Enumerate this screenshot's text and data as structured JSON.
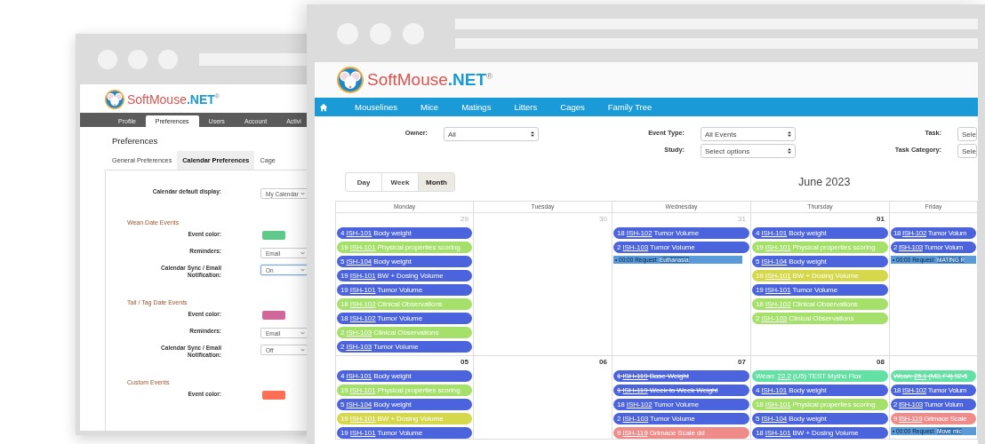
{
  "back_window": {
    "logo": {
      "name": "SoftMouse",
      "suffix": ".NET",
      "mark": "®"
    },
    "nav": [
      {
        "label": "Profile",
        "selected": false
      },
      {
        "label": "Preferences",
        "selected": true
      },
      {
        "label": "Users",
        "selected": false
      },
      {
        "label": "Account",
        "selected": false
      },
      {
        "label": "Activi",
        "selected": false
      }
    ],
    "heading": "Preferences",
    "tabs": [
      {
        "label": "General Preferences",
        "selected": false
      },
      {
        "label": "Calendar Preferences",
        "selected": true
      },
      {
        "label": "Cage",
        "selected": false
      }
    ],
    "settings": [
      {
        "kind": "select",
        "label": "Calendar default display:",
        "value": "My Calendar",
        "focused": false
      },
      {
        "kind": "heading",
        "label": "Wean Date Events"
      },
      {
        "kind": "color",
        "label": "Event color:",
        "color": "#5ec98a"
      },
      {
        "kind": "select",
        "label": "Reminders:",
        "value": "Email",
        "focused": false
      },
      {
        "kind": "select",
        "label": "Calendar Sync / Email Notification:",
        "value": "On",
        "focused": true
      },
      {
        "kind": "heading",
        "label": "Tail / Tag Date Events"
      },
      {
        "kind": "color",
        "label": "Event color:",
        "color": "#d0679a"
      },
      {
        "kind": "select",
        "label": "Reminders:",
        "value": "Email",
        "focused": false
      },
      {
        "kind": "select",
        "label": "Calendar Sync / Email Notification:",
        "value": "Off",
        "focused": false
      },
      {
        "kind": "heading",
        "label": "Custom Events"
      },
      {
        "kind": "color",
        "label": "Event color:",
        "color": "#ff6e55"
      }
    ]
  },
  "front_window": {
    "logo": {
      "name": "SoftMouse",
      "suffix": ".NET",
      "mark": "®"
    },
    "nav": [
      "Mouselines",
      "Mice",
      "Matings",
      "Litters",
      "Cages",
      "Family Tree"
    ],
    "filters": [
      [
        {
          "label": "Owner:",
          "value": "All"
        }
      ],
      [
        {
          "label": "Event Type:",
          "value": "All Events"
        },
        {
          "label": "Study:",
          "value": "Select options"
        }
      ],
      [
        {
          "label": "Task:",
          "value": "Sele"
        },
        {
          "label": "Task Category:",
          "value": "Sele"
        }
      ]
    ],
    "views": [
      {
        "label": "Day",
        "selected": false
      },
      {
        "label": "Week",
        "selected": false
      },
      {
        "label": "Month",
        "selected": true
      }
    ],
    "month_title": "June 2023",
    "weekdays": [
      "Monday",
      "Tuesday",
      "Wednesday",
      "Thursday",
      "Friday"
    ],
    "weeks": [
      {
        "days": [
          {
            "date": "29",
            "other_month": true,
            "events": [
              {
                "kind": "event",
                "count": "4",
                "study": "ISH-101",
                "title": "Body weight",
                "color": "#4b63dc",
                "struck": false
              },
              {
                "kind": "event",
                "count": "19",
                "study": "ISH-101",
                "title": "Physical properties scoring",
                "color": "#a5e16a",
                "struck": false
              },
              {
                "kind": "event",
                "count": "5",
                "study": "ISH-104",
                "title": "Body weight",
                "color": "#4b63dc",
                "struck": false
              },
              {
                "kind": "event",
                "count": "19",
                "study": "ISH-101",
                "title": "BW + Dosing Volume",
                "color": "#4b63dc",
                "struck": false
              },
              {
                "kind": "event",
                "count": "19",
                "study": "ISH-101",
                "title": "Tumor Volume",
                "color": "#4b63dc",
                "struck": false
              },
              {
                "kind": "event",
                "count": "18",
                "study": "ISH-102",
                "title": "Clinical Observations",
                "color": "#a5e16a",
                "struck": false
              },
              {
                "kind": "event",
                "count": "18",
                "study": "ISH-102",
                "title": "Tumor Volume",
                "color": "#4b63dc",
                "struck": false
              },
              {
                "kind": "event",
                "count": "2",
                "study": "ISH-103",
                "title": "Clinical Observations",
                "color": "#a5e16a",
                "struck": false
              },
              {
                "kind": "event",
                "count": "2",
                "study": "ISH-103",
                "title": "Tumor Volume",
                "color": "#4b63dc",
                "struck": false
              }
            ]
          },
          {
            "date": "30",
            "other_month": true
          },
          {
            "date": "31",
            "other_month": true,
            "events": [
              {
                "kind": "event",
                "count": "18",
                "study": "ISH-102",
                "title": "Tumor Volume",
                "color": "#4b63dc",
                "struck": false
              },
              {
                "kind": "event",
                "count": "2",
                "study": "ISH-103",
                "title": "Tumor Volume",
                "color": "#4b63dc",
                "struck": false
              },
              {
                "kind": "request",
                "time": "• 00:00 Request:",
                "title": "Euthanasia"
              }
            ]
          },
          {
            "date": "01",
            "other_month": false,
            "events": [
              {
                "kind": "event",
                "count": "4",
                "study": "ISH-101",
                "title": "Body weight",
                "color": "#4b63dc",
                "struck": false
              },
              {
                "kind": "event",
                "count": "19",
                "study": "ISH-101",
                "title": "Physical properties scoring",
                "color": "#a5e16a",
                "struck": false
              },
              {
                "kind": "event",
                "count": "5",
                "study": "ISH-104",
                "title": "Body weight",
                "color": "#4b63dc",
                "struck": false
              },
              {
                "kind": "event",
                "count": "19",
                "study": "ISH-101",
                "title": "BW + Dosing Volume",
                "color": "#d6d84c",
                "struck": false
              },
              {
                "kind": "event",
                "count": "19",
                "study": "ISH-101",
                "title": "Tumor Volume",
                "color": "#4b63dc",
                "struck": false
              },
              {
                "kind": "event",
                "count": "18",
                "study": "ISH-102",
                "title": "Clinical Observations",
                "color": "#a5e16a",
                "struck": false
              },
              {
                "kind": "event",
                "count": "2",
                "study": "ISH-103",
                "title": "Clinical Observations",
                "color": "#a5e16a",
                "struck": false
              }
            ]
          },
          {
            "events": [
              {
                "kind": "event",
                "count": "18",
                "study": "ISH-102",
                "title": "Tumor Volum",
                "color": "#4b63dc",
                "struck": false
              },
              {
                "kind": "event",
                "count": "2",
                "study": "ISH-103",
                "title": "Tumor Volum",
                "color": "#4b63dc",
                "struck": false
              },
              {
                "kind": "request",
                "time": "• 00:00 Request:",
                "title": "MATING R"
              }
            ]
          }
        ]
      },
      {
        "days": [
          {
            "date": "05",
            "other_month": false,
            "events": [
              {
                "kind": "event",
                "count": "4",
                "study": "ISH-101",
                "title": "Body weight",
                "color": "#4b63dc",
                "struck": false
              },
              {
                "kind": "event",
                "count": "19",
                "study": "ISH-101",
                "title": "Physical properties scoring",
                "color": "#a5e16a",
                "struck": false
              },
              {
                "kind": "event",
                "count": "5",
                "study": "ISH-104",
                "title": "Body weight",
                "color": "#4b63dc",
                "struck": false
              },
              {
                "kind": "event",
                "count": "19",
                "study": "ISH-101",
                "title": "BW + Dosing Volume",
                "color": "#d6d84c",
                "struck": false
              },
              {
                "kind": "event",
                "count": "19",
                "study": "ISH-101",
                "title": "Tumor Volume",
                "color": "#4b63dc",
                "struck": false
              }
            ]
          },
          {
            "date": "06",
            "other_month": false
          },
          {
            "date": "07",
            "other_month": false,
            "events": [
              {
                "kind": "event",
                "count": "1",
                "study": "ISH-119",
                "title": "Base Weight",
                "color": "#4b63dc",
                "struck": true
              },
              {
                "kind": "event",
                "count": "1",
                "study": "ISH-119",
                "title": "Week to Week Weight",
                "color": "#4b63dc",
                "struck": true
              },
              {
                "kind": "event",
                "count": "18",
                "study": "ISH-102",
                "title": "Tumor Volume",
                "color": "#4b63dc",
                "struck": false
              },
              {
                "kind": "event",
                "count": "2",
                "study": "ISH-103",
                "title": "Tumor Volume",
                "color": "#4b63dc",
                "struck": false
              },
              {
                "kind": "event",
                "count": "9",
                "study": "ISH-119",
                "title": "Grimace Scale dd",
                "color": "#ef8c8a",
                "struck": false
              }
            ]
          },
          {
            "date": "08",
            "other_month": false,
            "events": [
              {
                "kind": "event",
                "count": "Wean:",
                "study": "22.2",
                "title": "(U5) TEST Mytho Flox",
                "color": "#63e0a3",
                "struck": false
              },
              {
                "kind": "event",
                "count": "4",
                "study": "ISH-101",
                "title": "Body weight",
                "color": "#4b63dc",
                "struck": false
              },
              {
                "kind": "event",
                "count": "18",
                "study": "ISH-101",
                "title": "Physical properties scoring",
                "color": "#a5e16a",
                "struck": false
              },
              {
                "kind": "event",
                "count": "5",
                "study": "ISH-104",
                "title": "Body weight",
                "color": "#4b63dc",
                "struck": false
              },
              {
                "kind": "event",
                "count": "18",
                "study": "ISH-101",
                "title": "BW + Dosing Volume",
                "color": "#4b63dc",
                "struck": false
              }
            ]
          },
          {
            "events": [
              {
                "kind": "event",
                "count": "Wean:",
                "study": "25.1",
                "title": "(M3, F4) 92-5",
                "color": "#63e0a3",
                "struck": true
              },
              {
                "kind": "event",
                "count": "18",
                "study": "ISH-102",
                "title": "Tumor Volum",
                "color": "#4b63dc",
                "struck": false
              },
              {
                "kind": "event",
                "count": "2",
                "study": "ISH-103",
                "title": "Tumor Volum",
                "color": "#4b63dc",
                "struck": false
              },
              {
                "kind": "event",
                "count": "9",
                "study": "ISH-119",
                "title": "Grimace Scale",
                "color": "#ef8c8a",
                "struck": false
              },
              {
                "kind": "request",
                "time": "• 00:00 Request:",
                "title": "Move mic"
              }
            ]
          }
        ]
      }
    ]
  }
}
